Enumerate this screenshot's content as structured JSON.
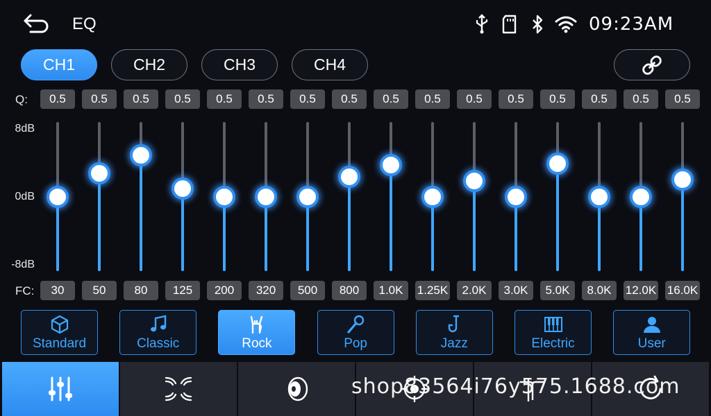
{
  "header": {
    "title": "EQ",
    "time": "09:23AM",
    "status_icons": [
      "usb-icon",
      "sd-card-icon",
      "bluetooth-icon",
      "wifi-icon"
    ]
  },
  "channels": [
    {
      "label": "CH1",
      "active": true
    },
    {
      "label": "CH2",
      "active": false
    },
    {
      "label": "CH3",
      "active": false
    },
    {
      "label": "CH4",
      "active": false
    }
  ],
  "link_icon": "link-icon",
  "q_label": "Q:",
  "fc_label": "FC:",
  "db_labels": {
    "top": "8dB",
    "mid": "0dB",
    "bottom": "-8dB"
  },
  "db_range": [
    -8,
    8
  ],
  "bands": [
    {
      "q": "0.5",
      "fc": "30",
      "gain": 0
    },
    {
      "q": "0.5",
      "fc": "50",
      "gain": 2.8
    },
    {
      "q": "0.5",
      "fc": "80",
      "gain": 5
    },
    {
      "q": "0.5",
      "fc": "125",
      "gain": 1
    },
    {
      "q": "0.5",
      "fc": "200",
      "gain": 0
    },
    {
      "q": "0.5",
      "fc": "320",
      "gain": 0
    },
    {
      "q": "0.5",
      "fc": "500",
      "gain": 0
    },
    {
      "q": "0.5",
      "fc": "800",
      "gain": 2.4
    },
    {
      "q": "0.5",
      "fc": "1.0K",
      "gain": 3.8
    },
    {
      "q": "0.5",
      "fc": "1.25K",
      "gain": 0
    },
    {
      "q": "0.5",
      "fc": "2.0K",
      "gain": 1.9
    },
    {
      "q": "0.5",
      "fc": "3.0K",
      "gain": 0
    },
    {
      "q": "0.5",
      "fc": "5.0K",
      "gain": 4
    },
    {
      "q": "0.5",
      "fc": "8.0K",
      "gain": 0
    },
    {
      "q": "0.5",
      "fc": "12.0K",
      "gain": 0
    },
    {
      "q": "0.5",
      "fc": "16.0K",
      "gain": 2.1
    }
  ],
  "presets": [
    {
      "label": "Standard",
      "icon": "cube-icon",
      "active": false
    },
    {
      "label": "Classic",
      "icon": "music-note-icon",
      "active": false
    },
    {
      "label": "Rock",
      "icon": "rock-hand-icon",
      "active": true
    },
    {
      "label": "Pop",
      "icon": "microphone-icon",
      "active": false
    },
    {
      "label": "Jazz",
      "icon": "saxophone-icon",
      "active": false
    },
    {
      "label": "Electric",
      "icon": "piano-icon",
      "active": false
    },
    {
      "label": "User",
      "icon": "user-icon",
      "active": false
    }
  ],
  "nav_tabs": [
    {
      "icon": "equalizer-icon",
      "active": true
    },
    {
      "icon": "sound-field-icon",
      "active": false
    },
    {
      "icon": "speaker-icon",
      "active": false
    },
    {
      "icon": "balance-target-icon",
      "active": false
    },
    {
      "icon": "crossover-icon",
      "active": false
    },
    {
      "icon": "reset-icon",
      "active": false
    }
  ],
  "watermark": "shop83564i76y575.1688.com",
  "colors": {
    "accent": "#3fa6ff",
    "background": "#0c0d13",
    "value_box": "#4a4c52",
    "nav_tab": "#252730"
  }
}
